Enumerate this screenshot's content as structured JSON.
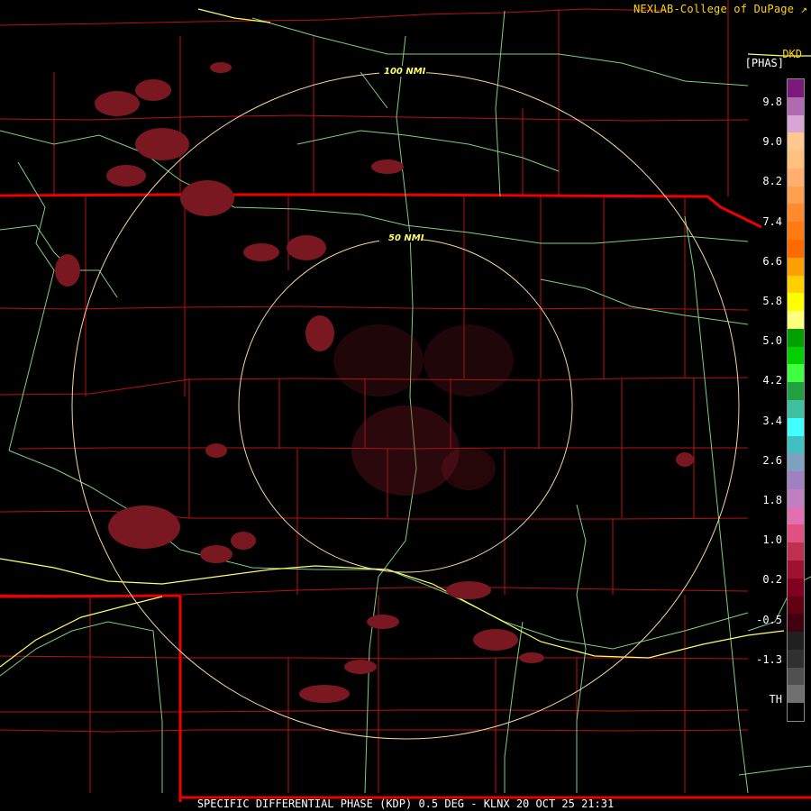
{
  "credit": "NEXLAB-College of DuPage ",
  "credit_icon": "external-link-icon",
  "site_code": "DKD",
  "units_label": "[PHAS]",
  "footer": "SPECIFIC DIFFERENTIAL PHASE (KDP) 0.5 DEG - KLNX 20 OCT 25 21:31",
  "range_rings": [
    {
      "label": "50 NMI",
      "range_nmi": 50
    },
    {
      "label": "100 NMI",
      "range_nmi": 100
    }
  ],
  "colorbar": {
    "ticks": [
      "9.8",
      "9.0",
      "8.2",
      "7.4",
      "6.6",
      "5.8",
      "5.0",
      "4.2",
      "3.4",
      "2.6",
      "1.8",
      "1.0",
      "0.2",
      "-0.5",
      "-1.3",
      "TH"
    ],
    "colors": [
      "#7a1a7a",
      "#b06ab0",
      "#d7a6d7",
      "#ffc890",
      "#ffc080",
      "#ffb070",
      "#ffa050",
      "#ff8a30",
      "#ff7a10",
      "#ff6a00",
      "#ffa000",
      "#ffd000",
      "#ffff00",
      "#ffff80",
      "#00a000",
      "#00d000",
      "#40ff40",
      "#20a040",
      "#40c0a0",
      "#40ffff",
      "#40c0c0",
      "#80a0c0",
      "#a080c0",
      "#c080c0",
      "#e070b0",
      "#e05080",
      "#c03050",
      "#a01030",
      "#800020",
      "#600010",
      "#400010",
      "#202020",
      "#303030",
      "#505050",
      "#707070",
      "#000000"
    ]
  },
  "colors": {
    "county_lines": "#cc1111",
    "state_lines": "#ee0000",
    "highways": "#88dd88",
    "interstates": "#ffff66",
    "rings": "#f4d6a0",
    "echo": "#7a1822"
  }
}
